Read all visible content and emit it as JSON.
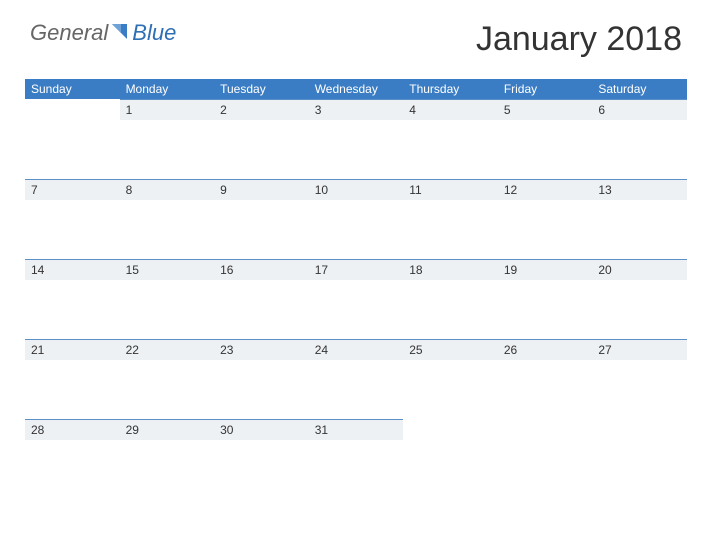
{
  "logo": {
    "general": "General",
    "blue": "Blue"
  },
  "title": "January 2018",
  "day_headers": [
    "Sunday",
    "Monday",
    "Tuesday",
    "Wednesday",
    "Thursday",
    "Friday",
    "Saturday"
  ],
  "weeks": [
    [
      "",
      "1",
      "2",
      "3",
      "4",
      "5",
      "6"
    ],
    [
      "7",
      "8",
      "9",
      "10",
      "11",
      "12",
      "13"
    ],
    [
      "14",
      "15",
      "16",
      "17",
      "18",
      "19",
      "20"
    ],
    [
      "21",
      "22",
      "23",
      "24",
      "25",
      "26",
      "27"
    ],
    [
      "28",
      "29",
      "30",
      "31",
      "",
      "",
      ""
    ]
  ]
}
